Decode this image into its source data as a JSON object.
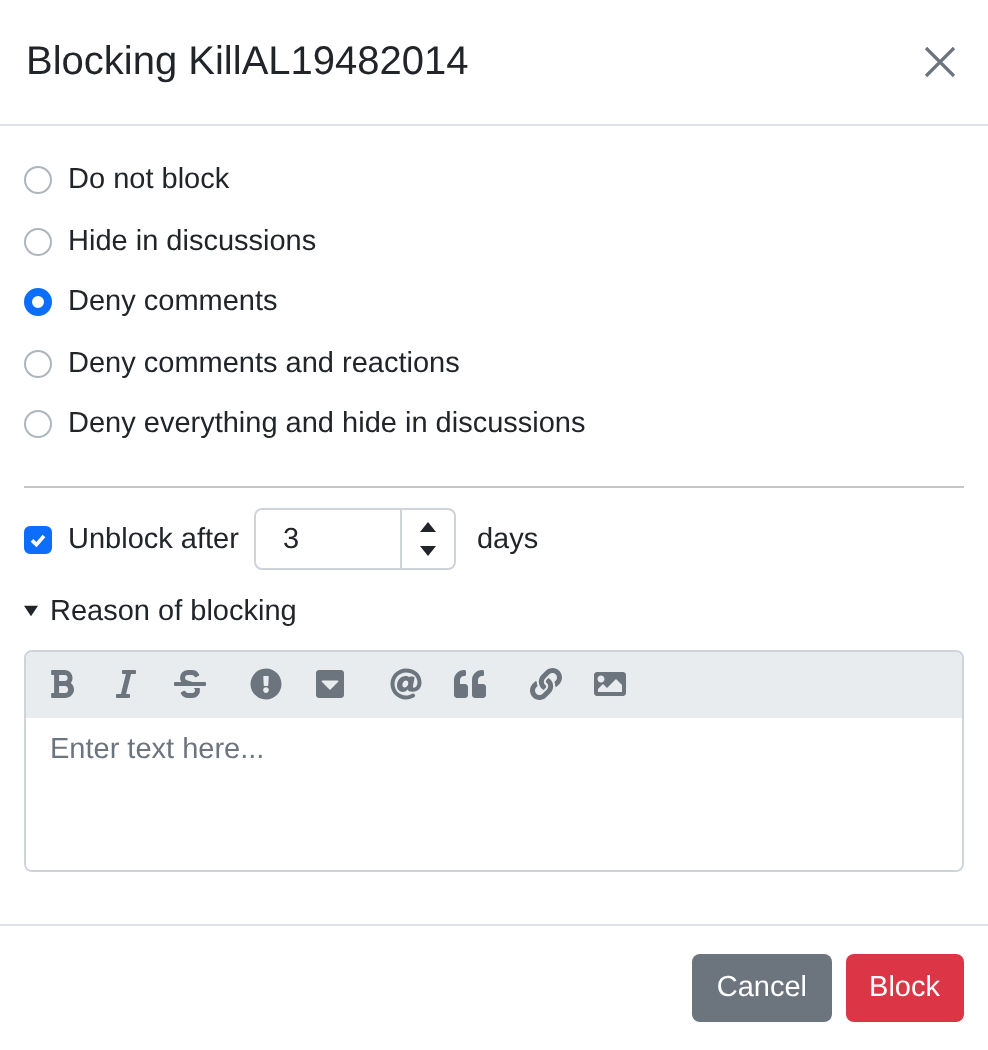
{
  "dialog": {
    "title": "Blocking KillAL19482014"
  },
  "options": [
    {
      "label": "Do not block",
      "selected": false
    },
    {
      "label": "Hide in discussions",
      "selected": false
    },
    {
      "label": "Deny comments",
      "selected": true
    },
    {
      "label": "Deny comments and reactions",
      "selected": false
    },
    {
      "label": "Deny everything and hide in discussions",
      "selected": false
    }
  ],
  "unblock": {
    "label": "Unblock after",
    "checked": true,
    "value": "3",
    "unit": "days"
  },
  "reason": {
    "label": "Reason of blocking",
    "expanded": true,
    "placeholder": "Enter text here..."
  },
  "buttons": [
    {
      "label": "Cancel",
      "kind": "secondary"
    },
    {
      "label": "Block",
      "kind": "danger"
    }
  ]
}
